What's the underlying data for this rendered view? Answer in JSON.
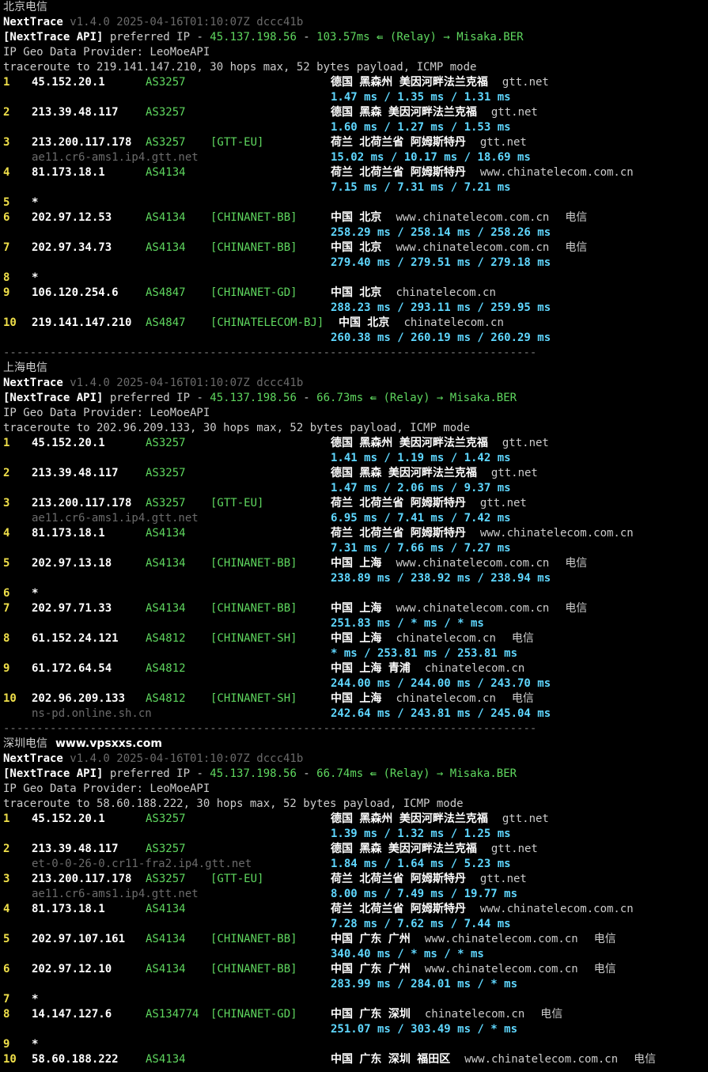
{
  "sections": [
    {
      "title": "北京电信",
      "site": "",
      "version_name": "NextTrace",
      "version_rest": " v1.4.0 2025-04-16T01:10:07Z dccc41b",
      "api_prefix": "[NextTrace API]",
      "api_text": " preferred IP - ",
      "api_ip": "45.137.198.56",
      "api_dash": " - ",
      "api_ms": "103.57ms",
      "relay_icon": "⇚",
      "relay": "(Relay) → Misaka.BER",
      "geo_provider": "IP Geo Data Provider: LeoMoeAPI",
      "traceroute": "traceroute to 219.141.147.210, 30 hops max, 52 bytes payload, ICMP mode",
      "hops": [
        {
          "n": "1",
          "ip": "45.152.20.1",
          "asn": "AS3257",
          "tag": "",
          "host": "",
          "geo": "德国 黑森州 美因河畔法兰克福",
          "domain": "gtt.net",
          "isp": "",
          "times": "1.47 ms / 1.35 ms / 1.31 ms"
        },
        {
          "n": "2",
          "ip": "213.39.48.117",
          "asn": "AS3257",
          "tag": "",
          "host": "",
          "geo": "德国 黑森 美因河畔法兰克福",
          "domain": "gtt.net",
          "isp": "",
          "times": "1.60 ms / 1.27 ms / 1.53 ms"
        },
        {
          "n": "3",
          "ip": "213.200.117.178",
          "asn": "AS3257",
          "tag": "[GTT-EU]",
          "host": "ae11.cr6-ams1.ip4.gtt.net",
          "geo": "荷兰 北荷兰省 阿姆斯特丹",
          "domain": "gtt.net",
          "isp": "",
          "times": "15.02 ms / 10.17 ms / 18.69 ms"
        },
        {
          "n": "4",
          "ip": "81.173.18.1",
          "asn": "AS4134",
          "tag": "",
          "host": "",
          "geo": "荷兰 北荷兰省 阿姆斯特丹",
          "domain": "www.chinatelecom.com.cn",
          "isp": "",
          "times": "7.15 ms / 7.31 ms / 7.21 ms"
        },
        {
          "n": "5",
          "star": true
        },
        {
          "n": "6",
          "ip": "202.97.12.53",
          "asn": "AS4134",
          "tag": "[CHINANET-BB]",
          "host": "",
          "geo": "中国 北京",
          "domain": "www.chinatelecom.com.cn",
          "isp": "电信",
          "times": "258.29 ms / 258.14 ms / 258.26 ms"
        },
        {
          "n": "7",
          "ip": "202.97.34.73",
          "asn": "AS4134",
          "tag": "[CHINANET-BB]",
          "host": "",
          "geo": "中国 北京",
          "domain": "www.chinatelecom.com.cn",
          "isp": "电信",
          "times": "279.40 ms / 279.51 ms / 279.18 ms"
        },
        {
          "n": "8",
          "star": true
        },
        {
          "n": "9",
          "ip": "106.120.254.6",
          "asn": "AS4847",
          "tag": "[CHINANET-GD]",
          "host": "",
          "geo": "中国 北京",
          "domain": "chinatelecom.cn",
          "isp": "",
          "times": "288.23 ms / 293.11 ms / 259.95 ms"
        },
        {
          "n": "10",
          "ip": "219.141.147.210",
          "asn": "AS4847",
          "tag": "[CHINATELECOM-BJ]",
          "host": "",
          "geo": "中国 北京",
          "domain": "chinatelecom.cn",
          "isp": "",
          "times": "260.38 ms / 260.19 ms / 260.29 ms",
          "geoShift": true
        }
      ]
    },
    {
      "title": "上海电信",
      "site": "",
      "version_name": "NextTrace",
      "version_rest": " v1.4.0 2025-04-16T01:10:07Z dccc41b",
      "api_prefix": "[NextTrace API]",
      "api_text": " preferred IP - ",
      "api_ip": "45.137.198.56",
      "api_dash": " - ",
      "api_ms": "66.73ms",
      "relay_icon": "⇚",
      "relay": "(Relay) → Misaka.BER",
      "geo_provider": "IP Geo Data Provider: LeoMoeAPI",
      "traceroute": "traceroute to 202.96.209.133, 30 hops max, 52 bytes payload, ICMP mode",
      "hops": [
        {
          "n": "1",
          "ip": "45.152.20.1",
          "asn": "AS3257",
          "tag": "",
          "host": "",
          "geo": "德国 黑森州 美因河畔法兰克福",
          "domain": "gtt.net",
          "isp": "",
          "times": "1.41 ms / 1.19 ms / 1.42 ms"
        },
        {
          "n": "2",
          "ip": "213.39.48.117",
          "asn": "AS3257",
          "tag": "",
          "host": "",
          "geo": "德国 黑森 美因河畔法兰克福",
          "domain": "gtt.net",
          "isp": "",
          "times": "1.47 ms / 2.06 ms / 9.37 ms"
        },
        {
          "n": "3",
          "ip": "213.200.117.178",
          "asn": "AS3257",
          "tag": "[GTT-EU]",
          "host": "ae11.cr6-ams1.ip4.gtt.net",
          "geo": "荷兰 北荷兰省 阿姆斯特丹",
          "domain": "gtt.net",
          "isp": "",
          "times": "6.95 ms / 7.41 ms / 7.42 ms"
        },
        {
          "n": "4",
          "ip": "81.173.18.1",
          "asn": "AS4134",
          "tag": "",
          "host": "",
          "geo": "荷兰 北荷兰省 阿姆斯特丹",
          "domain": "www.chinatelecom.com.cn",
          "isp": "",
          "times": "7.31 ms / 7.66 ms / 7.27 ms"
        },
        {
          "n": "5",
          "ip": "202.97.13.18",
          "asn": "AS4134",
          "tag": "[CHINANET-BB]",
          "host": "",
          "geo": "中国 上海",
          "domain": "www.chinatelecom.com.cn",
          "isp": "电信",
          "times": "238.89 ms / 238.92 ms / 238.94 ms"
        },
        {
          "n": "6",
          "star": true
        },
        {
          "n": "7",
          "ip": "202.97.71.33",
          "asn": "AS4134",
          "tag": "[CHINANET-BB]",
          "host": "",
          "geo": "中国 上海",
          "domain": "www.chinatelecom.com.cn",
          "isp": "电信",
          "times": "251.83 ms / * ms / * ms"
        },
        {
          "n": "8",
          "ip": "61.152.24.121",
          "asn": "AS4812",
          "tag": "[CHINANET-SH]",
          "host": "",
          "geo": "中国 上海",
          "domain": "chinatelecom.cn",
          "isp": "电信",
          "times": "* ms / 253.81 ms / 253.81 ms"
        },
        {
          "n": "9",
          "ip": "61.172.64.54",
          "asn": "AS4812",
          "tag": "",
          "host": "",
          "geo": "中国 上海 青浦",
          "domain": "chinatelecom.cn",
          "isp": "",
          "times": "244.00 ms / 244.00 ms / 243.70 ms"
        },
        {
          "n": "10",
          "ip": "202.96.209.133",
          "asn": "AS4812",
          "tag": "[CHINANET-SH]",
          "host": "ns-pd.online.sh.cn",
          "geo": "中国 上海",
          "domain": "chinatelecom.cn",
          "isp": "电信",
          "times": "242.64 ms / 243.81 ms / 245.04 ms"
        }
      ]
    },
    {
      "title": "深圳电信",
      "site": "www.vpsxxs.com",
      "version_name": "NextTrace",
      "version_rest": " v1.4.0 2025-04-16T01:10:07Z dccc41b",
      "api_prefix": "[NextTrace API]",
      "api_text": " preferred IP - ",
      "api_ip": "45.137.198.56",
      "api_dash": " - ",
      "api_ms": "66.74ms",
      "relay_icon": "⇚",
      "relay": "(Relay) → Misaka.BER",
      "geo_provider": "IP Geo Data Provider: LeoMoeAPI",
      "traceroute": "traceroute to 58.60.188.222, 30 hops max, 52 bytes payload, ICMP mode",
      "hops": [
        {
          "n": "1",
          "ip": "45.152.20.1",
          "asn": "AS3257",
          "tag": "",
          "host": "",
          "geo": "德国 黑森州 美因河畔法兰克福",
          "domain": "gtt.net",
          "isp": "",
          "times": "1.39 ms / 1.32 ms / 1.25 ms"
        },
        {
          "n": "2",
          "ip": "213.39.48.117",
          "asn": "AS3257",
          "tag": "",
          "host": "et-0-0-26-0.cr11-fra2.ip4.gtt.net",
          "geo": "德国 黑森 美因河畔法兰克福",
          "domain": "gtt.net",
          "isp": "",
          "times": "1.84 ms / 1.64 ms / 5.23 ms"
        },
        {
          "n": "3",
          "ip": "213.200.117.178",
          "asn": "AS3257",
          "tag": "[GTT-EU]",
          "host": "ae11.cr6-ams1.ip4.gtt.net",
          "geo": "荷兰 北荷兰省 阿姆斯特丹",
          "domain": "gtt.net",
          "isp": "",
          "times": "8.00 ms / 7.49 ms / 19.77 ms"
        },
        {
          "n": "4",
          "ip": "81.173.18.1",
          "asn": "AS4134",
          "tag": "",
          "host": "",
          "geo": "荷兰 北荷兰省 阿姆斯特丹",
          "domain": "www.chinatelecom.com.cn",
          "isp": "",
          "times": "7.28 ms / 7.62 ms / 7.44 ms"
        },
        {
          "n": "5",
          "ip": "202.97.107.161",
          "asn": "AS4134",
          "tag": "[CHINANET-BB]",
          "host": "",
          "geo": "中国 广东 广州",
          "domain": "www.chinatelecom.com.cn",
          "isp": "电信",
          "times": "340.40 ms / * ms / * ms"
        },
        {
          "n": "6",
          "ip": "202.97.12.10",
          "asn": "AS4134",
          "tag": "[CHINANET-BB]",
          "host": "",
          "geo": "中国 广东 广州",
          "domain": "www.chinatelecom.com.cn",
          "isp": "电信",
          "times": "283.99 ms / 284.01 ms / * ms"
        },
        {
          "n": "7",
          "star": true
        },
        {
          "n": "8",
          "ip": "14.147.127.6",
          "asn": "AS134774",
          "tag": "[CHINANET-GD]",
          "host": "",
          "geo": "中国 广东 深圳",
          "domain": "chinatelecom.cn",
          "isp": "电信",
          "times": "251.07 ms / 303.49 ms / * ms"
        },
        {
          "n": "9",
          "star": true
        },
        {
          "n": "10",
          "ip": "58.60.188.222",
          "asn": "AS4134",
          "tag": "",
          "host": "",
          "geo": "中国 广东 深圳 福田区",
          "domain": "www.chinatelecom.com.cn",
          "isp": "电信",
          "times": ""
        }
      ]
    }
  ],
  "separator": "--------------------------------------------------------------------------------",
  "colors": {
    "bg": "#000000",
    "white": "#ffffff",
    "gray": "#6b6b6b",
    "green": "#5fd75f",
    "yellow": "#f0e04a",
    "cyan": "#5fd7ff"
  }
}
